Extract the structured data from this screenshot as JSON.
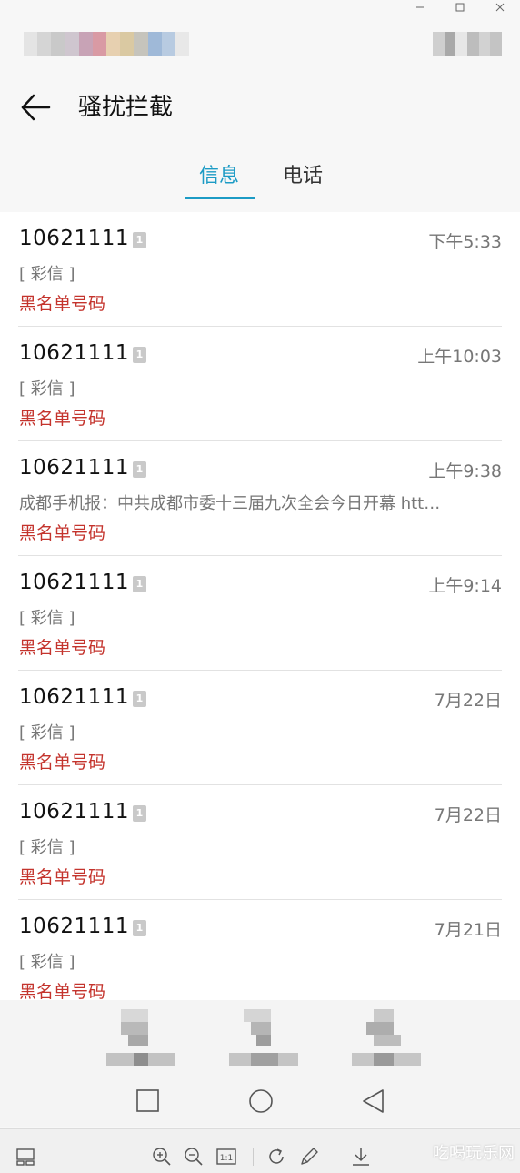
{
  "header": {
    "title": "骚扰拦截"
  },
  "tabs": [
    {
      "label": "信息",
      "active": true
    },
    {
      "label": "电话",
      "active": false
    }
  ],
  "messages": [
    {
      "sender": "10621111",
      "sim": "1",
      "time": "下午5:33",
      "preview": "[ 彩信 ]",
      "tag": "黑名单号码"
    },
    {
      "sender": "10621111",
      "sim": "1",
      "time": "上午10:03",
      "preview": "[ 彩信 ]",
      "tag": "黑名单号码"
    },
    {
      "sender": "10621111",
      "sim": "1",
      "time": "上午9:38",
      "preview": "成都手机报：中共成都市委十三届九次全会今日开幕 htt…",
      "tag": "黑名单号码"
    },
    {
      "sender": "10621111",
      "sim": "1",
      "time": "上午9:14",
      "preview": "[ 彩信 ]",
      "tag": "黑名单号码"
    },
    {
      "sender": "10621111",
      "sim": "1",
      "time": "7月22日",
      "preview": "[ 彩信 ]",
      "tag": "黑名单号码"
    },
    {
      "sender": "10621111",
      "sim": "1",
      "time": "7月22日",
      "preview": "[ 彩信 ]",
      "tag": "黑名单号码"
    },
    {
      "sender": "10621111",
      "sim": "1",
      "time": "7月21日",
      "preview": "[ 彩信 ]",
      "tag": "黑名单号码"
    }
  ],
  "watermark": "吃喝玩乐网",
  "colors": {
    "accent": "#1c9bc5",
    "tag_red": "#c4342d"
  }
}
